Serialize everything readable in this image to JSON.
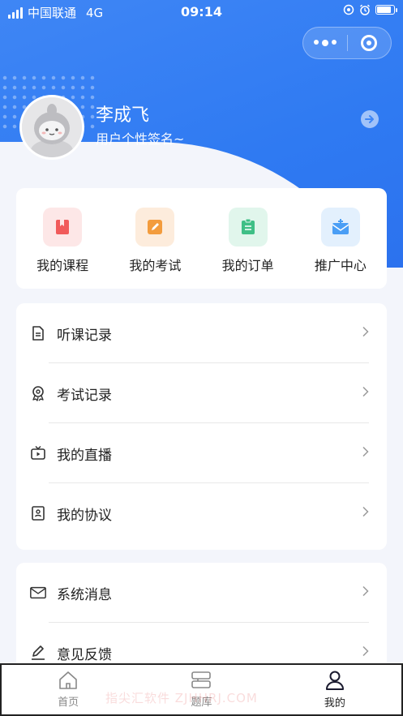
{
  "status_bar": {
    "carrier": "中国联通",
    "network": "4G",
    "time": "09:14",
    "battery_level": 0.85
  },
  "user": {
    "name": "李成飞",
    "signature": "用户个性签名~"
  },
  "quick_actions": [
    {
      "label": "我的课程",
      "icon": "bookmark-book-icon",
      "color": "#f15b5b",
      "bg": "#fde7e7"
    },
    {
      "label": "我的考试",
      "icon": "pencil-note-icon",
      "color": "#f39c3d",
      "bg": "#fdecdc"
    },
    {
      "label": "我的订单",
      "icon": "clipboard-icon",
      "color": "#3fbf86",
      "bg": "#e1f6ec"
    },
    {
      "label": "推广中心",
      "icon": "mail-plus-icon",
      "color": "#4a9ef5",
      "bg": "#e3f0fd"
    }
  ],
  "menu_group1": [
    {
      "label": "听课记录",
      "icon": "document-icon"
    },
    {
      "label": "考试记录",
      "icon": "award-ribbon-icon"
    },
    {
      "label": "我的直播",
      "icon": "tv-play-icon"
    },
    {
      "label": "我的协议",
      "icon": "contract-icon"
    }
  ],
  "menu_group2": [
    {
      "label": "系统消息",
      "icon": "envelope-icon"
    },
    {
      "label": "意见反馈",
      "icon": "edit-pen-icon"
    }
  ],
  "tabs": [
    {
      "label": "首页",
      "icon": "home-icon",
      "active": false
    },
    {
      "label": "题库",
      "icon": "question-bank-icon",
      "active": false
    },
    {
      "label": "我的",
      "icon": "user-icon",
      "active": true
    }
  ],
  "watermark": "指尖汇软件 ZJHHRJ.COM",
  "colors": {
    "primary": "#3f86f5",
    "background": "#f3f5fb"
  }
}
